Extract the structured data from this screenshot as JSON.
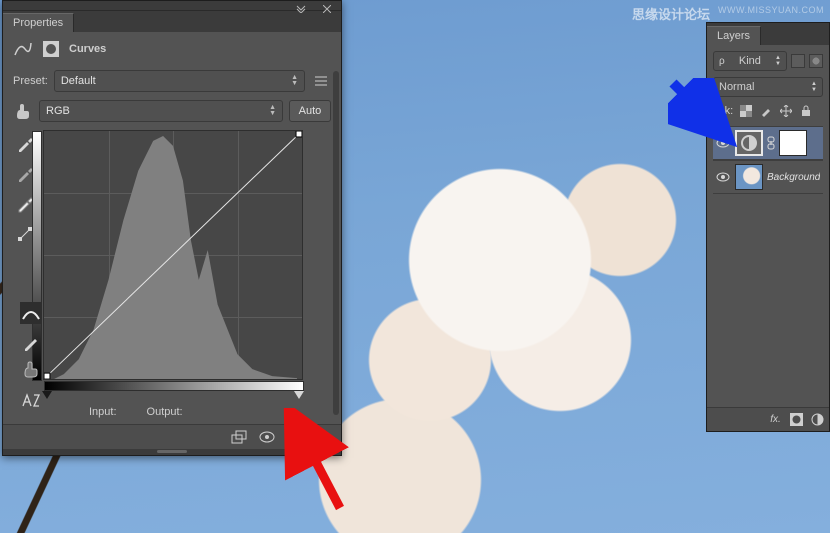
{
  "watermark": {
    "text": "思缘设计论坛",
    "url": "WWW.MISSYUAN.COM"
  },
  "properties": {
    "tab": "Properties",
    "title": "Curves",
    "preset_label": "Preset:",
    "preset_value": "Default",
    "channel_value": "RGB",
    "auto_label": "Auto",
    "input_label": "Input:",
    "output_label": "Output:"
  },
  "layers": {
    "tab": "Layers",
    "filter_label": "Kind",
    "blend_mode": "Normal",
    "lock_label": "ock:",
    "items": [
      {
        "name": "",
        "kind": "curves-adj"
      },
      {
        "name": "Background",
        "kind": "image"
      }
    ]
  },
  "chart_data": {
    "type": "line",
    "title": "Curves",
    "xlabel": "Input",
    "ylabel": "Output",
    "xlim": [
      0,
      255
    ],
    "ylim": [
      0,
      255
    ],
    "series": [
      {
        "name": "RGB curve",
        "x": [
          0,
          255
        ],
        "y": [
          0,
          255
        ]
      }
    ],
    "control_points": [
      {
        "input": 0,
        "output": 0
      },
      {
        "input": 255,
        "output": 255
      }
    ],
    "histogram_note": "Image histogram shown behind curve; main mass between ~40 and ~200 with peak near 120."
  }
}
